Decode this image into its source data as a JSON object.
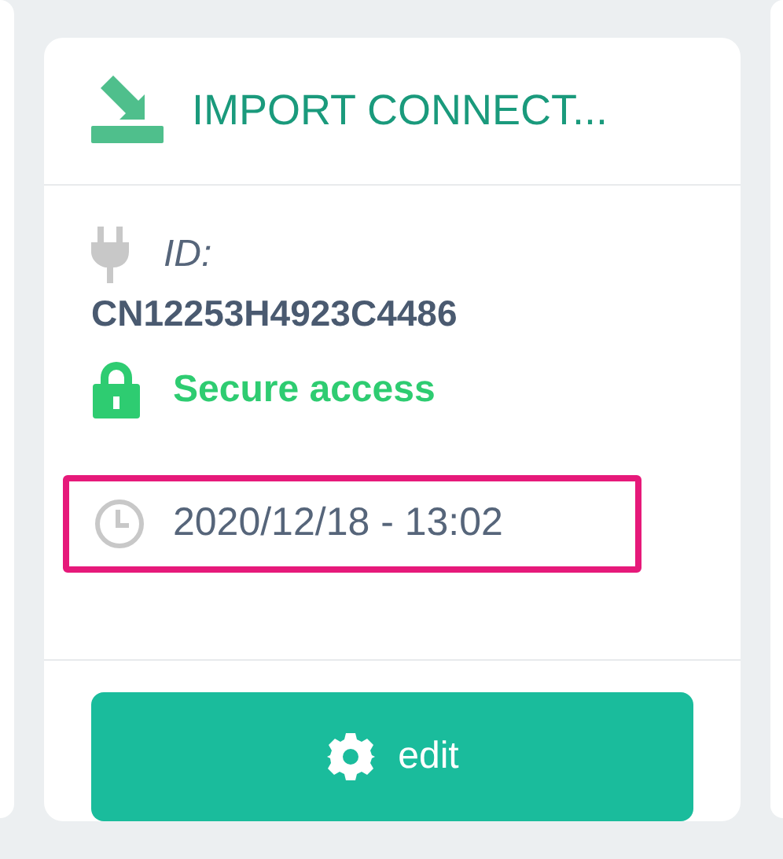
{
  "card": {
    "title": "IMPORT CONNECT...",
    "id_label": "ID:",
    "id_value": "CN12253H4923C4486",
    "access": "Secure access",
    "timestamp": {
      "text": "2020/12/18 - 13:02",
      "highlighted": true
    },
    "button": "edit"
  }
}
